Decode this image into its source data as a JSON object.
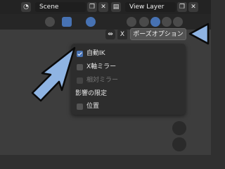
{
  "header": {
    "scene_label": "Scene",
    "view_layer_label": "View Layer"
  },
  "pose_options_button": "ポーズオプション",
  "x_toggle": "X",
  "menu": {
    "items": [
      {
        "label": "自動IK",
        "checked": true,
        "enabled": true
      },
      {
        "label": "X軸ミラー",
        "checked": false,
        "enabled": true
      },
      {
        "label": "相対ミラー",
        "checked": false,
        "enabled": false
      },
      {
        "label": "影響の限定",
        "heading": true
      },
      {
        "label": "位置",
        "checked": false,
        "enabled": true
      }
    ]
  },
  "colors": {
    "accent": "#4772b3",
    "arrow_fill": "#8fb4e3",
    "arrow_stroke": "#0a0a0a"
  }
}
